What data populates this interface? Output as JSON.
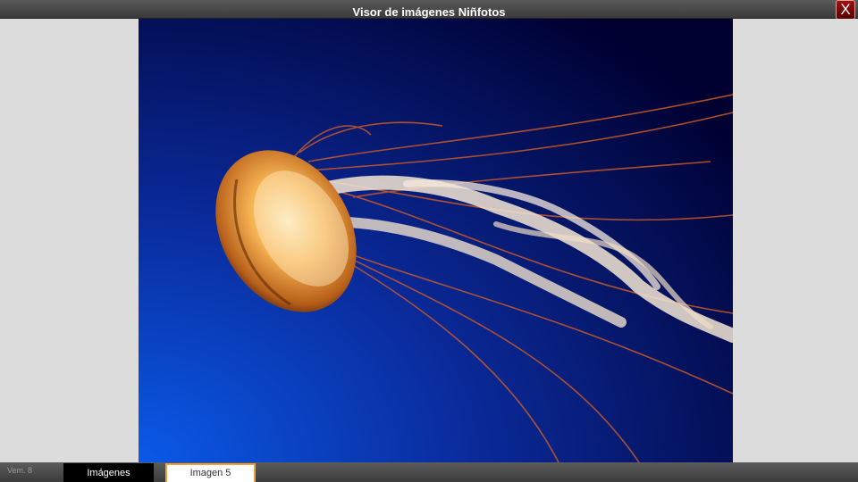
{
  "window": {
    "title": "Visor de imágenes Niñfotos",
    "close_label": "X"
  },
  "photo": {
    "subject": "jellyfish-photo",
    "background_colors": [
      "#0a1660",
      "#0650d8",
      "#000030"
    ],
    "accent_color": "#e89030"
  },
  "footer": {
    "version": "Vem. 8",
    "tab_images_label": "Imágenes",
    "tab_current_label": "Imagen 5"
  }
}
